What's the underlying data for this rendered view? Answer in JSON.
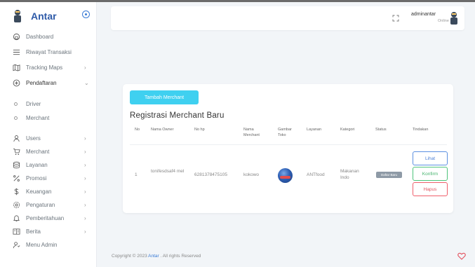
{
  "brand": {
    "name": "Antar"
  },
  "colors": {
    "accent": "#3a7bd5",
    "brand": "#2e5aa8",
    "add_button": "#3fd0f0",
    "view": "#4a7fd6",
    "confirm": "#45b36c",
    "delete": "#e2515d",
    "badge": "#8e9aa6"
  },
  "sidebar": {
    "items": [
      {
        "label": "Dashboard",
        "icon": "home-icon"
      },
      {
        "label": "Riwayat Transaksi",
        "icon": "list-icon"
      },
      {
        "label": "Tracking Maps",
        "icon": "map-icon",
        "chevron": "›"
      },
      {
        "label": "Pendaftaran",
        "icon": "plus-circle-icon",
        "chevron": "⌄"
      },
      {
        "label": "Driver",
        "sub": true
      },
      {
        "label": "Merchant",
        "sub": true
      },
      {
        "label": "Users",
        "icon": "user-icon",
        "chevron": "›"
      },
      {
        "label": "Merchant",
        "icon": "cart-icon",
        "chevron": "›"
      },
      {
        "label": "Layanan",
        "icon": "layers-icon",
        "chevron": "›"
      },
      {
        "label": "Promosi",
        "icon": "percent-icon",
        "chevron": "›"
      },
      {
        "label": "Keuangan",
        "icon": "dollar-icon",
        "chevron": "›"
      },
      {
        "label": "Pengaturan",
        "icon": "gear-icon",
        "chevron": "›"
      },
      {
        "label": "Pemberitahuan",
        "icon": "bell-icon",
        "chevron": "›"
      },
      {
        "label": "Berita",
        "icon": "newspaper-icon",
        "chevron": "›"
      },
      {
        "label": "Menu Admin",
        "icon": "admin-icon"
      }
    ]
  },
  "header": {
    "user_name": "adminantar",
    "user_status": "Online"
  },
  "card": {
    "add_button": "Tambah Merchant",
    "title": "Registrasi Merchant Baru",
    "columns": [
      "No",
      "Nama Owner",
      "No hp",
      "Nama Merchant",
      "Gambar Toko",
      "Layanan",
      "Kategori",
      "Status",
      "Tindakan"
    ],
    "row": {
      "no": "1",
      "owner": "tonifesdsaf4 mel",
      "phone": "6281378475105",
      "merchant": "kokowo",
      "layanan": "ANTfood",
      "kategori": "Makanan Indo",
      "status": "Daftar Baru",
      "actions": {
        "view": "Lihat",
        "confirm": "Konfirm",
        "delete": "Hapus"
      }
    }
  },
  "footer": {
    "prefix": "Copyright © 2023 ",
    "brand": "Antar",
    "suffix": " . All rights Reserved"
  }
}
